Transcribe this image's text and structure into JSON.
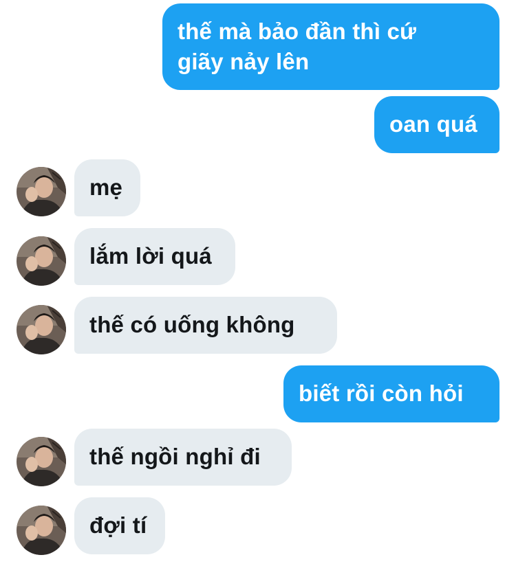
{
  "conversation": {
    "messages": [
      {
        "sender": "me",
        "text": "thế mà bảo đần thì cứ\ngiãy nảy lên"
      },
      {
        "sender": "me",
        "text": "oan quá"
      },
      {
        "sender": "other",
        "text": "mẹ",
        "avatar_icon": "user-avatar-photo"
      },
      {
        "sender": "other",
        "text": "lắm lời quá",
        "avatar_icon": "user-avatar-photo"
      },
      {
        "sender": "other",
        "text": "thế có uống không",
        "avatar_icon": "user-avatar-photo"
      },
      {
        "sender": "me",
        "text": "biết rồi còn hỏi"
      },
      {
        "sender": "other",
        "text": "thế ngồi nghỉ đi",
        "avatar_icon": "user-avatar-photo"
      },
      {
        "sender": "other",
        "text": "đợi tí",
        "avatar_icon": "user-avatar-photo"
      }
    ]
  },
  "colors": {
    "outgoing_bubble": "#1da1f2",
    "outgoing_text": "#ffffff",
    "incoming_bubble": "#e6ecf0",
    "incoming_text": "#14171a",
    "background": "#ffffff"
  }
}
